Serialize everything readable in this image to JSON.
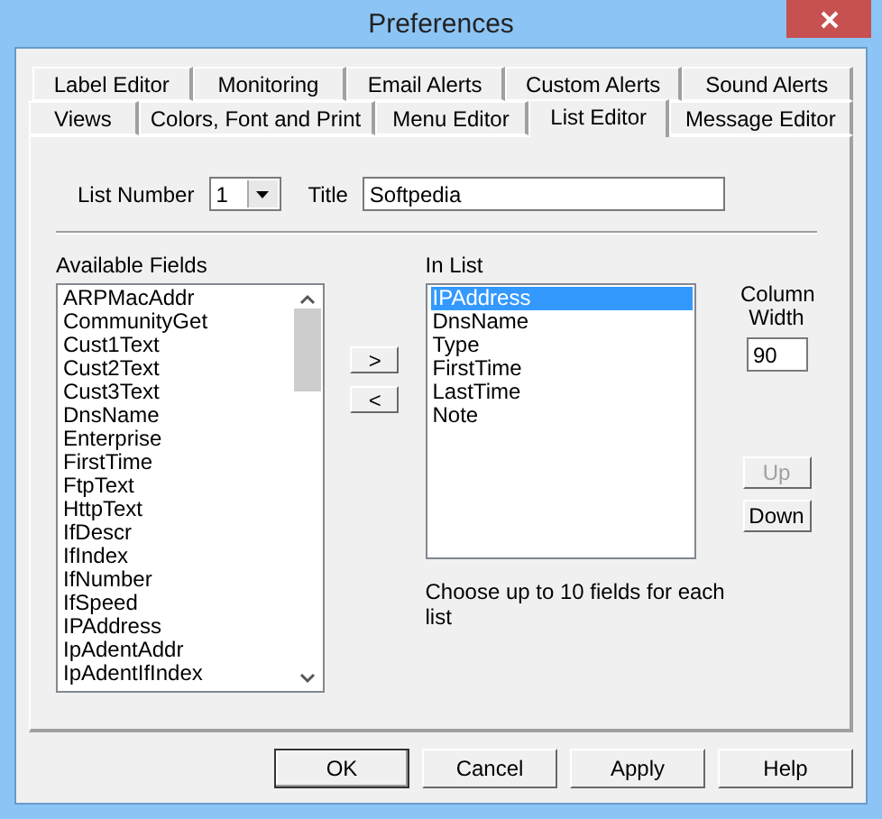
{
  "window": {
    "title": "Preferences"
  },
  "tab_rows": [
    [
      {
        "label": "Label Editor",
        "selected": false
      },
      {
        "label": "Monitoring",
        "selected": false
      },
      {
        "label": "Email Alerts",
        "selected": false
      },
      {
        "label": "Custom Alerts",
        "selected": false
      },
      {
        "label": "Sound Alerts",
        "selected": false
      }
    ],
    [
      {
        "label": "Views",
        "selected": false
      },
      {
        "label": "Colors, Font and Print",
        "selected": false
      },
      {
        "label": "Menu Editor",
        "selected": false
      },
      {
        "label": "List Editor",
        "selected": true
      },
      {
        "label": "Message Editor",
        "selected": false
      }
    ]
  ],
  "list_number": {
    "label": "List Number",
    "value": "1"
  },
  "title_field": {
    "label": "Title",
    "value": "Softpedia"
  },
  "available_fields": {
    "label": "Available Fields",
    "items": [
      {
        "label": "ARPMacAddr",
        "selected": false
      },
      {
        "label": "CommunityGet",
        "selected": false
      },
      {
        "label": "Cust1Text",
        "selected": false
      },
      {
        "label": "Cust2Text",
        "selected": false
      },
      {
        "label": "Cust3Text",
        "selected": false
      },
      {
        "label": "DnsName",
        "selected": false
      },
      {
        "label": "Enterprise",
        "selected": false
      },
      {
        "label": "FirstTime",
        "selected": false
      },
      {
        "label": "FtpText",
        "selected": false
      },
      {
        "label": "HttpText",
        "selected": false
      },
      {
        "label": "IfDescr",
        "selected": false
      },
      {
        "label": "IfIndex",
        "selected": false
      },
      {
        "label": "IfNumber",
        "selected": false
      },
      {
        "label": "IfSpeed",
        "selected": false
      },
      {
        "label": "IPAddress",
        "selected": false
      },
      {
        "label": "IpAdentAddr",
        "selected": false
      },
      {
        "label": "IpAdentIfIndex",
        "selected": false
      }
    ]
  },
  "move_buttons": [
    ">",
    "<"
  ],
  "in_list": {
    "label": "In List",
    "items": [
      {
        "label": "IPAddress",
        "selected": true
      },
      {
        "label": "DnsName",
        "selected": false
      },
      {
        "label": "Type",
        "selected": false
      },
      {
        "label": "FirstTime",
        "selected": false
      },
      {
        "label": "LastTime",
        "selected": false
      },
      {
        "label": "Note",
        "selected": false
      }
    ]
  },
  "column_width": {
    "label": "Column Width",
    "value": "90"
  },
  "order_buttons": [
    {
      "label": "Up",
      "disabled": true
    },
    {
      "label": "Down",
      "disabled": false
    }
  ],
  "hint": "Choose up to 10 fields for each list",
  "buttons": [
    {
      "label": "OK",
      "default": true
    },
    {
      "label": "Cancel",
      "default": false
    },
    {
      "label": "Apply",
      "default": false
    },
    {
      "label": "Help",
      "default": false
    }
  ]
}
